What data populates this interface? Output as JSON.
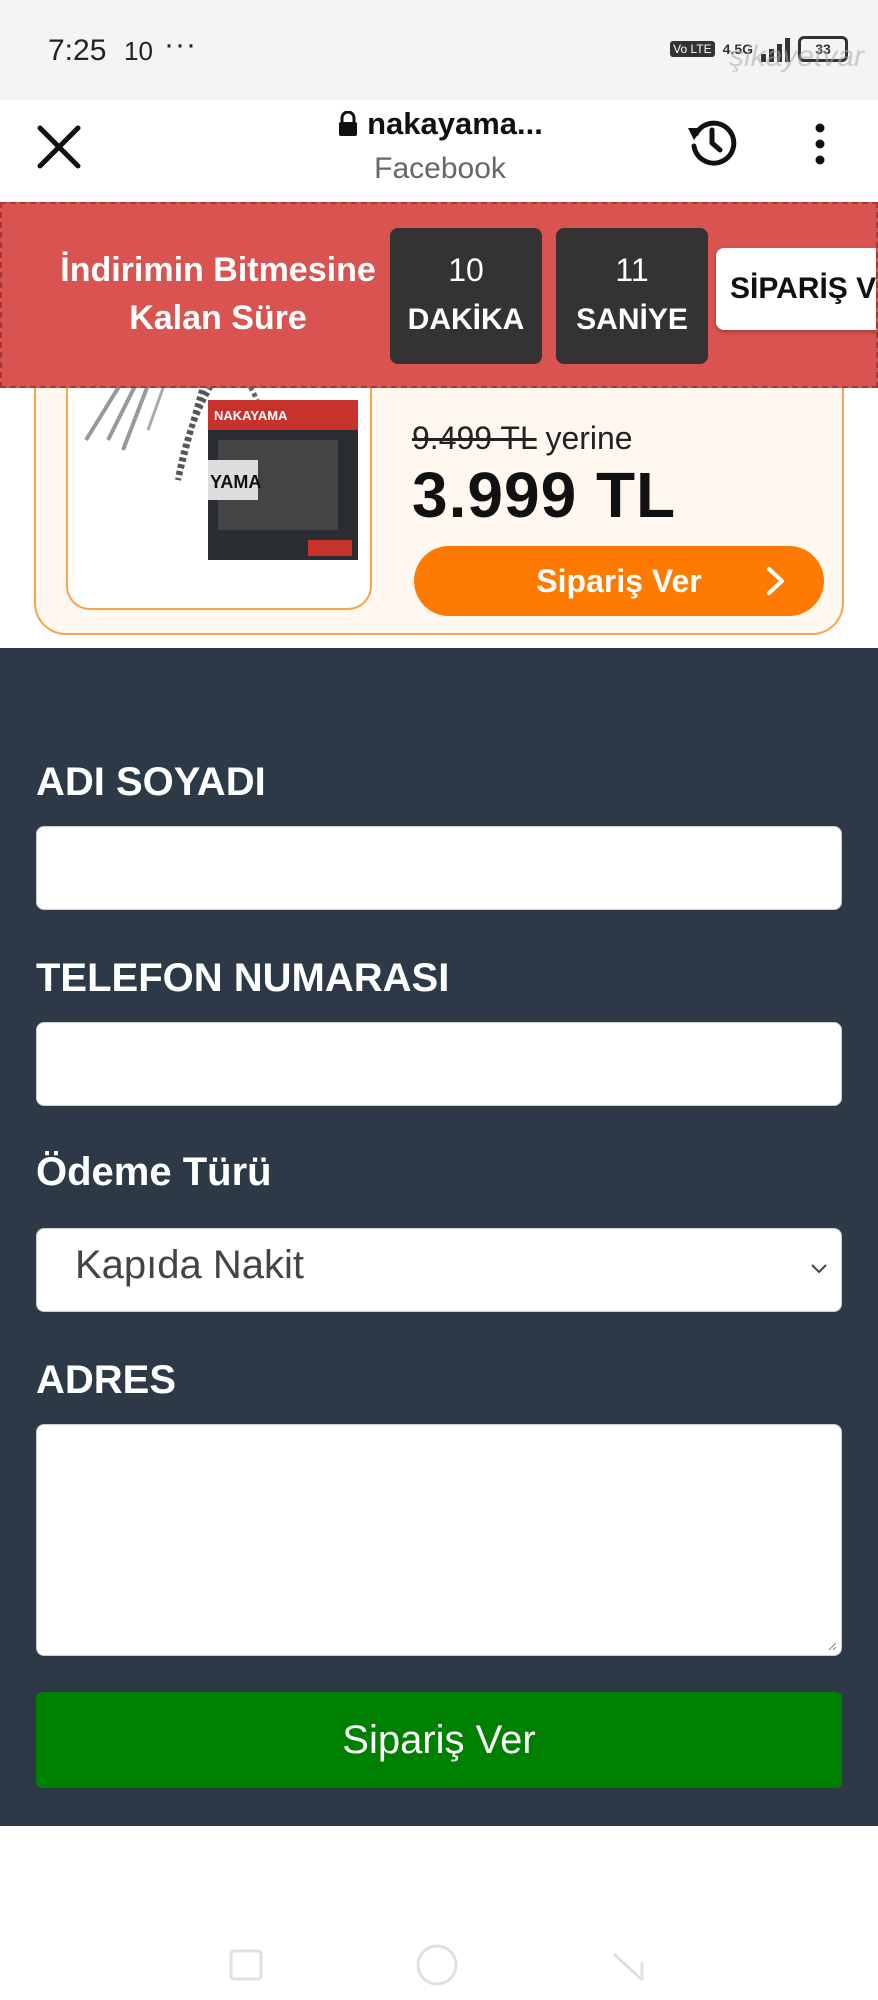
{
  "status_bar": {
    "time": "7:25",
    "notif": "10",
    "more": "···",
    "volte": "Vo LTE",
    "network": "4.5G",
    "battery": "33",
    "watermark": "şikayetvar"
  },
  "browser": {
    "url": "nakayama...",
    "source": "Facebook",
    "icons": [
      "close-icon",
      "lock-icon",
      "history-icon",
      "more-vert-icon"
    ]
  },
  "countdown": {
    "label_line1": "İndirimin Bitmesine",
    "label_line2": "Kalan Süre",
    "minutes": "10",
    "minutes_unit": "DAKİKA",
    "seconds": "11",
    "seconds_unit": "SANİYE",
    "order_button": "SİPARİŞ VER",
    "bg_color": "#d95450"
  },
  "product": {
    "brand_text": "NAKAYAMA",
    "box_label": "YAMA",
    "old_price": "9.499 TL",
    "old_price_suffix": "yerine",
    "new_price": "3.999 TL",
    "order_button": "Sipariş Ver",
    "accent_color": "#ff7a00"
  },
  "form": {
    "name_label": "ADI SOYADI",
    "name_value": "",
    "phone_label": "TELEFON NUMARASI",
    "phone_value": "",
    "payment_label": "Ödeme Türü",
    "payment_value": "Kapıda Nakit",
    "address_label": "ADRES",
    "address_value": "",
    "submit": "Sipariş Ver",
    "bg_color": "#2d3947",
    "submit_color": "#008000"
  },
  "nav_bar": {
    "icons": [
      "recents-icon",
      "home-icon",
      "back-icon"
    ]
  }
}
